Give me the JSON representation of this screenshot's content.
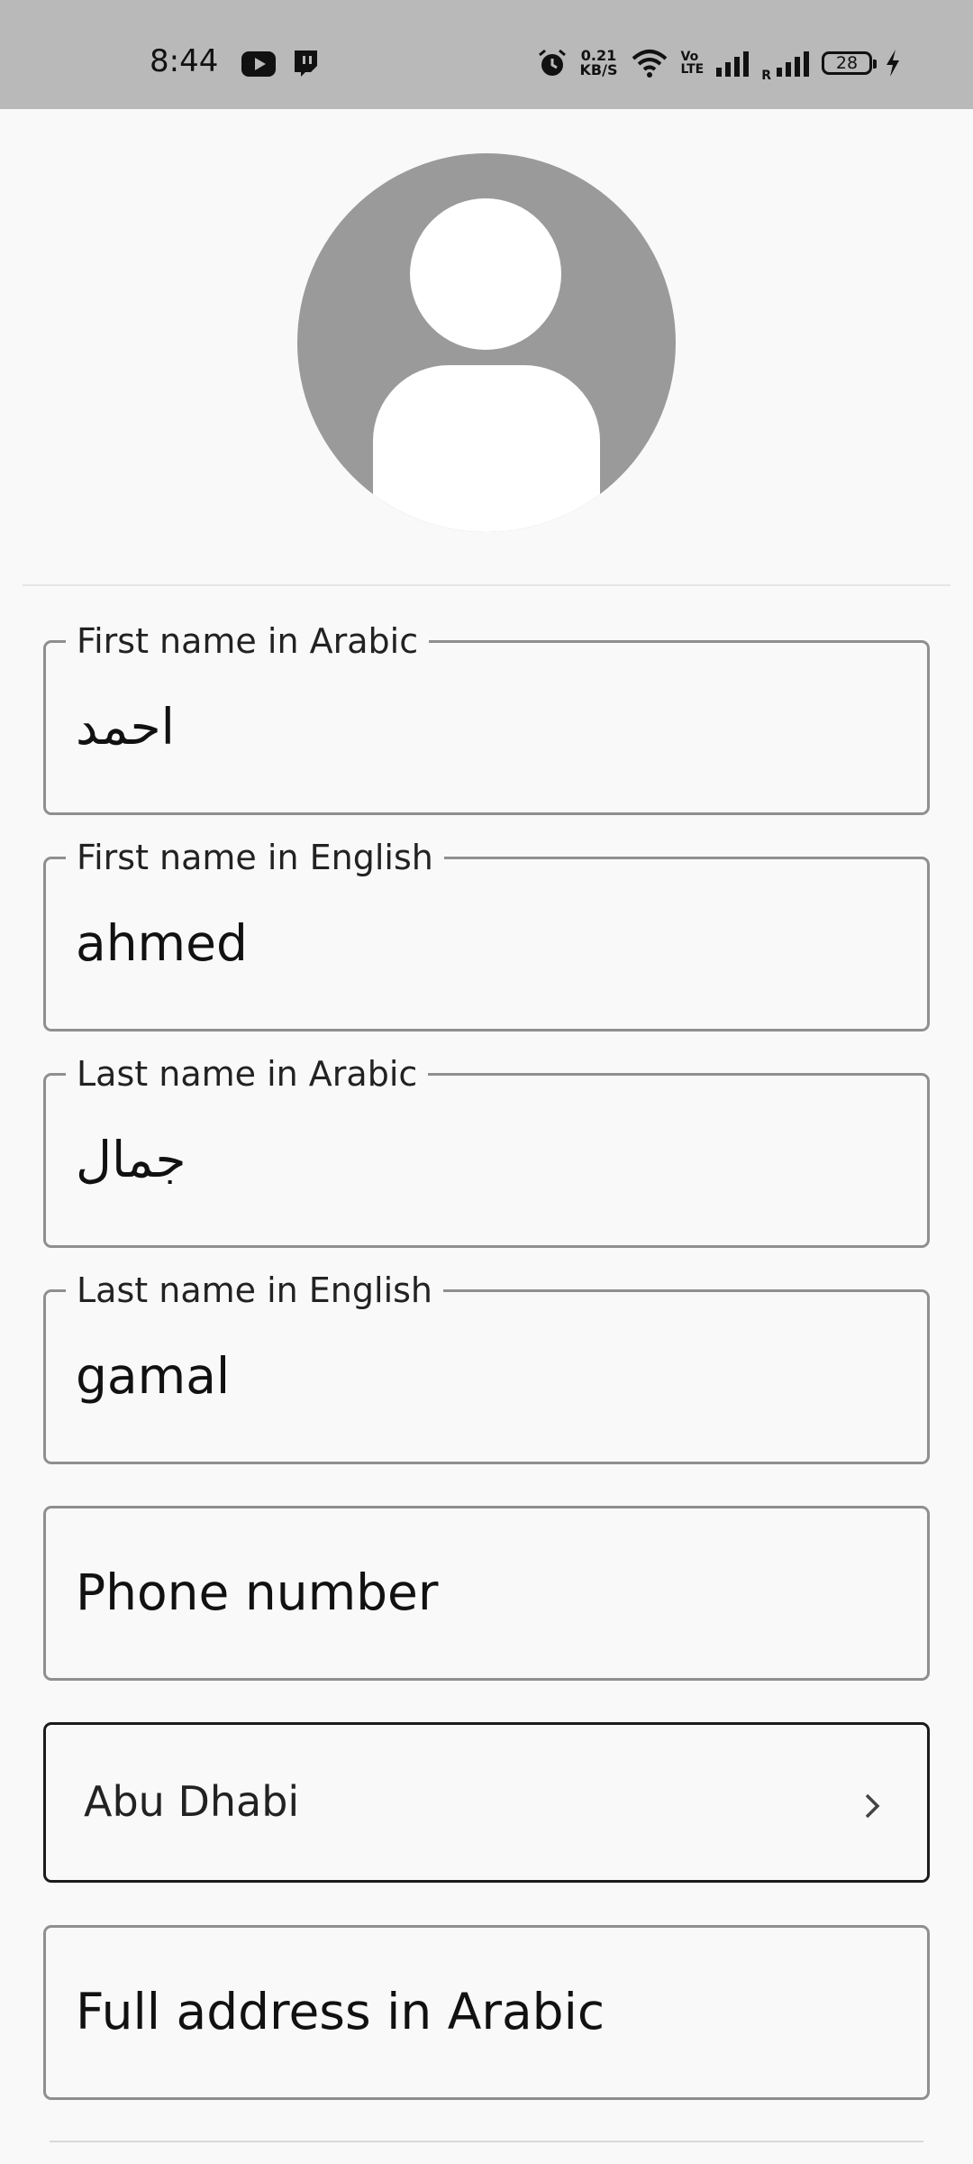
{
  "status_bar": {
    "time": "8:44",
    "network_speed_value": "0.21",
    "network_speed_unit": "KB/S",
    "volte_top": "Vo",
    "volte_bottom": "LTE",
    "roaming": "R",
    "battery": "28"
  },
  "profile": {
    "avatar_icon": "default-person-icon"
  },
  "form": {
    "first_name_ar": {
      "label": "First name in Arabic",
      "value": "احمد"
    },
    "first_name_en": {
      "label": "First name in English",
      "value": "ahmed"
    },
    "last_name_ar": {
      "label": "Last name in Arabic",
      "value": "جمال"
    },
    "last_name_en": {
      "label": "Last name in English",
      "value": "gamal"
    },
    "phone": {
      "placeholder": "Phone number"
    },
    "city": {
      "value": "Abu Dhabi"
    },
    "address_ar": {
      "placeholder": "Full address in Arabic"
    }
  }
}
